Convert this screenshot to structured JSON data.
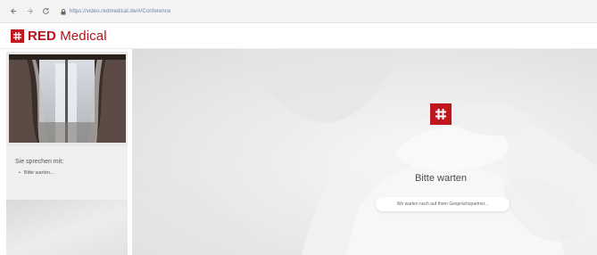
{
  "browser": {
    "back_icon": "arrow-left-icon",
    "forward_icon": "arrow-right-icon",
    "reload_icon": "reload-icon",
    "lock_icon": "lock-icon",
    "url": "https://video.redmedical.de/#/Conference"
  },
  "header": {
    "logo_icon": "hash-logo-icon",
    "logo_bold": "RED",
    "logo_rest": " Medical",
    "brand_color": "#c0171e"
  },
  "sidebar": {
    "participants_title": "Sie sprechen mit:",
    "participants": [
      "Bitte warten..."
    ]
  },
  "main": {
    "logo_icon": "hash-logo-icon",
    "status_title": "Bitte warten",
    "status_message": "Wir warten noch auf Ihren Gesprächspartner..."
  }
}
